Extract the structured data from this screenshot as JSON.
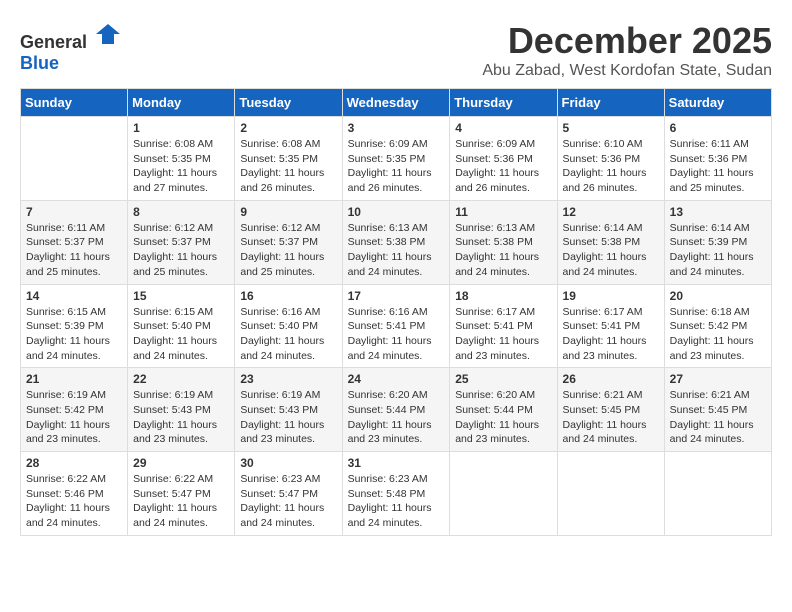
{
  "logo": {
    "general": "General",
    "blue": "Blue"
  },
  "title": "December 2025",
  "subtitle": "Abu Zabad, West Kordofan State, Sudan",
  "header_days": [
    "Sunday",
    "Monday",
    "Tuesday",
    "Wednesday",
    "Thursday",
    "Friday",
    "Saturday"
  ],
  "weeks": [
    [
      {
        "day": "",
        "sunrise": "",
        "sunset": "",
        "daylight": ""
      },
      {
        "day": "1",
        "sunrise": "Sunrise: 6:08 AM",
        "sunset": "Sunset: 5:35 PM",
        "daylight": "Daylight: 11 hours and 27 minutes."
      },
      {
        "day": "2",
        "sunrise": "Sunrise: 6:08 AM",
        "sunset": "Sunset: 5:35 PM",
        "daylight": "Daylight: 11 hours and 26 minutes."
      },
      {
        "day": "3",
        "sunrise": "Sunrise: 6:09 AM",
        "sunset": "Sunset: 5:35 PM",
        "daylight": "Daylight: 11 hours and 26 minutes."
      },
      {
        "day": "4",
        "sunrise": "Sunrise: 6:09 AM",
        "sunset": "Sunset: 5:36 PM",
        "daylight": "Daylight: 11 hours and 26 minutes."
      },
      {
        "day": "5",
        "sunrise": "Sunrise: 6:10 AM",
        "sunset": "Sunset: 5:36 PM",
        "daylight": "Daylight: 11 hours and 26 minutes."
      },
      {
        "day": "6",
        "sunrise": "Sunrise: 6:11 AM",
        "sunset": "Sunset: 5:36 PM",
        "daylight": "Daylight: 11 hours and 25 minutes."
      }
    ],
    [
      {
        "day": "7",
        "sunrise": "Sunrise: 6:11 AM",
        "sunset": "Sunset: 5:37 PM",
        "daylight": "Daylight: 11 hours and 25 minutes."
      },
      {
        "day": "8",
        "sunrise": "Sunrise: 6:12 AM",
        "sunset": "Sunset: 5:37 PM",
        "daylight": "Daylight: 11 hours and 25 minutes."
      },
      {
        "day": "9",
        "sunrise": "Sunrise: 6:12 AM",
        "sunset": "Sunset: 5:37 PM",
        "daylight": "Daylight: 11 hours and 25 minutes."
      },
      {
        "day": "10",
        "sunrise": "Sunrise: 6:13 AM",
        "sunset": "Sunset: 5:38 PM",
        "daylight": "Daylight: 11 hours and 24 minutes."
      },
      {
        "day": "11",
        "sunrise": "Sunrise: 6:13 AM",
        "sunset": "Sunset: 5:38 PM",
        "daylight": "Daylight: 11 hours and 24 minutes."
      },
      {
        "day": "12",
        "sunrise": "Sunrise: 6:14 AM",
        "sunset": "Sunset: 5:38 PM",
        "daylight": "Daylight: 11 hours and 24 minutes."
      },
      {
        "day": "13",
        "sunrise": "Sunrise: 6:14 AM",
        "sunset": "Sunset: 5:39 PM",
        "daylight": "Daylight: 11 hours and 24 minutes."
      }
    ],
    [
      {
        "day": "14",
        "sunrise": "Sunrise: 6:15 AM",
        "sunset": "Sunset: 5:39 PM",
        "daylight": "Daylight: 11 hours and 24 minutes."
      },
      {
        "day": "15",
        "sunrise": "Sunrise: 6:15 AM",
        "sunset": "Sunset: 5:40 PM",
        "daylight": "Daylight: 11 hours and 24 minutes."
      },
      {
        "day": "16",
        "sunrise": "Sunrise: 6:16 AM",
        "sunset": "Sunset: 5:40 PM",
        "daylight": "Daylight: 11 hours and 24 minutes."
      },
      {
        "day": "17",
        "sunrise": "Sunrise: 6:16 AM",
        "sunset": "Sunset: 5:41 PM",
        "daylight": "Daylight: 11 hours and 24 minutes."
      },
      {
        "day": "18",
        "sunrise": "Sunrise: 6:17 AM",
        "sunset": "Sunset: 5:41 PM",
        "daylight": "Daylight: 11 hours and 23 minutes."
      },
      {
        "day": "19",
        "sunrise": "Sunrise: 6:17 AM",
        "sunset": "Sunset: 5:41 PM",
        "daylight": "Daylight: 11 hours and 23 minutes."
      },
      {
        "day": "20",
        "sunrise": "Sunrise: 6:18 AM",
        "sunset": "Sunset: 5:42 PM",
        "daylight": "Daylight: 11 hours and 23 minutes."
      }
    ],
    [
      {
        "day": "21",
        "sunrise": "Sunrise: 6:19 AM",
        "sunset": "Sunset: 5:42 PM",
        "daylight": "Daylight: 11 hours and 23 minutes."
      },
      {
        "day": "22",
        "sunrise": "Sunrise: 6:19 AM",
        "sunset": "Sunset: 5:43 PM",
        "daylight": "Daylight: 11 hours and 23 minutes."
      },
      {
        "day": "23",
        "sunrise": "Sunrise: 6:19 AM",
        "sunset": "Sunset: 5:43 PM",
        "daylight": "Daylight: 11 hours and 23 minutes."
      },
      {
        "day": "24",
        "sunrise": "Sunrise: 6:20 AM",
        "sunset": "Sunset: 5:44 PM",
        "daylight": "Daylight: 11 hours and 23 minutes."
      },
      {
        "day": "25",
        "sunrise": "Sunrise: 6:20 AM",
        "sunset": "Sunset: 5:44 PM",
        "daylight": "Daylight: 11 hours and 23 minutes."
      },
      {
        "day": "26",
        "sunrise": "Sunrise: 6:21 AM",
        "sunset": "Sunset: 5:45 PM",
        "daylight": "Daylight: 11 hours and 24 minutes."
      },
      {
        "day": "27",
        "sunrise": "Sunrise: 6:21 AM",
        "sunset": "Sunset: 5:45 PM",
        "daylight": "Daylight: 11 hours and 24 minutes."
      }
    ],
    [
      {
        "day": "28",
        "sunrise": "Sunrise: 6:22 AM",
        "sunset": "Sunset: 5:46 PM",
        "daylight": "Daylight: 11 hours and 24 minutes."
      },
      {
        "day": "29",
        "sunrise": "Sunrise: 6:22 AM",
        "sunset": "Sunset: 5:47 PM",
        "daylight": "Daylight: 11 hours and 24 minutes."
      },
      {
        "day": "30",
        "sunrise": "Sunrise: 6:23 AM",
        "sunset": "Sunset: 5:47 PM",
        "daylight": "Daylight: 11 hours and 24 minutes."
      },
      {
        "day": "31",
        "sunrise": "Sunrise: 6:23 AM",
        "sunset": "Sunset: 5:48 PM",
        "daylight": "Daylight: 11 hours and 24 minutes."
      },
      {
        "day": "",
        "sunrise": "",
        "sunset": "",
        "daylight": ""
      },
      {
        "day": "",
        "sunrise": "",
        "sunset": "",
        "daylight": ""
      },
      {
        "day": "",
        "sunrise": "",
        "sunset": "",
        "daylight": ""
      }
    ]
  ]
}
